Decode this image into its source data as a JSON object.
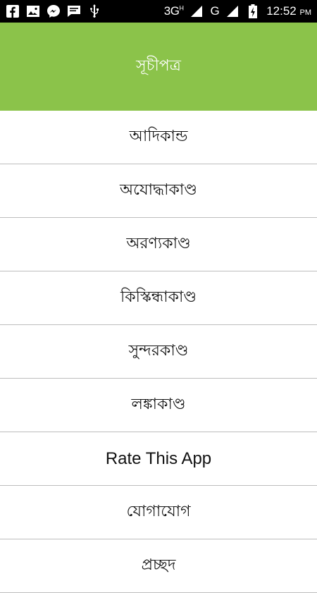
{
  "status_bar": {
    "left_icons": [
      "facebook-icon",
      "gallery-icon",
      "messenger-icon",
      "sms-icon",
      "usb-icon"
    ],
    "network": "3G",
    "network_sup": "H",
    "network2": "G",
    "time": "12:52",
    "ampm": "PM"
  },
  "toolbar": {
    "title": "সূচীপত্র",
    "background_color": "#8bc34a"
  },
  "menu": {
    "items": [
      {
        "label": "আদিকান্ড"
      },
      {
        "label": "অযোদ্ধাকাণ্ড"
      },
      {
        "label": "অরণ্যকাণ্ড"
      },
      {
        "label": "কিস্কিন্ধাকাণ্ড"
      },
      {
        "label": "সুন্দরকাণ্ড"
      },
      {
        "label": "লঙ্কাকাণ্ড"
      },
      {
        "label": "Rate This App"
      },
      {
        "label": "যোগাযোগ"
      },
      {
        "label": "প্রচ্ছদ"
      }
    ]
  }
}
